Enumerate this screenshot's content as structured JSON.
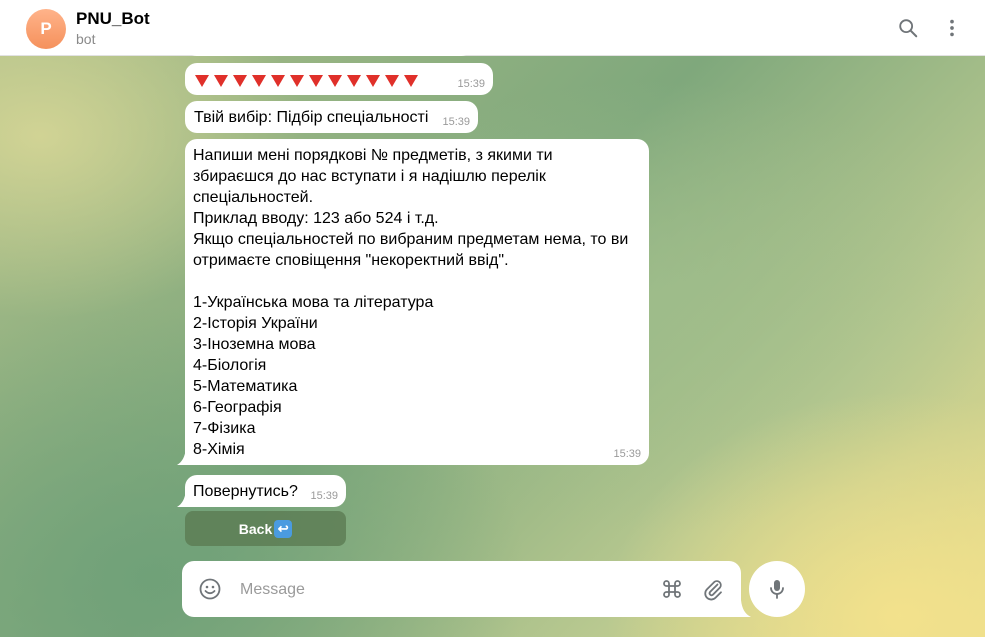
{
  "header": {
    "avatar_letter": "P",
    "title": "PNU_Bot",
    "subtitle": "bot",
    "search_icon": "search-icon",
    "menu_icon": "more-vertical-icon"
  },
  "messages": [
    {
      "text": "🔻🔻🔻🔻🔻🔻🔻🔻🔻🔻🔻🔻",
      "time": "15:39",
      "indicator_count": 12
    },
    {
      "text": "Твій вибір: Підбір спеціальності",
      "time": "15:39"
    },
    {
      "text": "Напиши мені порядкові № предметів, з якими ти\nзбираєшся до нас вступати і я надішлю перелік\nспеціальностей.\nПриклад вводу: 123 або 524 і т.д.\nЯкщо спеціальностей по вибраним предметам нема, то ви\nотримаєте сповіщення \"некоректний ввід\".\n\n1-Українська мова та література\n2-Історія України\n3-Іноземна мова\n4-Біологія\n5-Математика\n6-Географія\n7-Фізика\n8-Хімія",
      "time": "15:39"
    },
    {
      "text": "Повернутись?",
      "time": "15:39"
    }
  ],
  "keyboard": {
    "button_label": "Back",
    "button_emoji": "↩"
  },
  "composer": {
    "placeholder": "Message",
    "emoji_icon": "smiley-icon",
    "commands_icon": "command-icon",
    "attach_icon": "paperclip-icon",
    "mic_icon": "microphone-icon"
  },
  "colors": {
    "indicator": "#e0302a",
    "avatar": "#f5915c"
  }
}
